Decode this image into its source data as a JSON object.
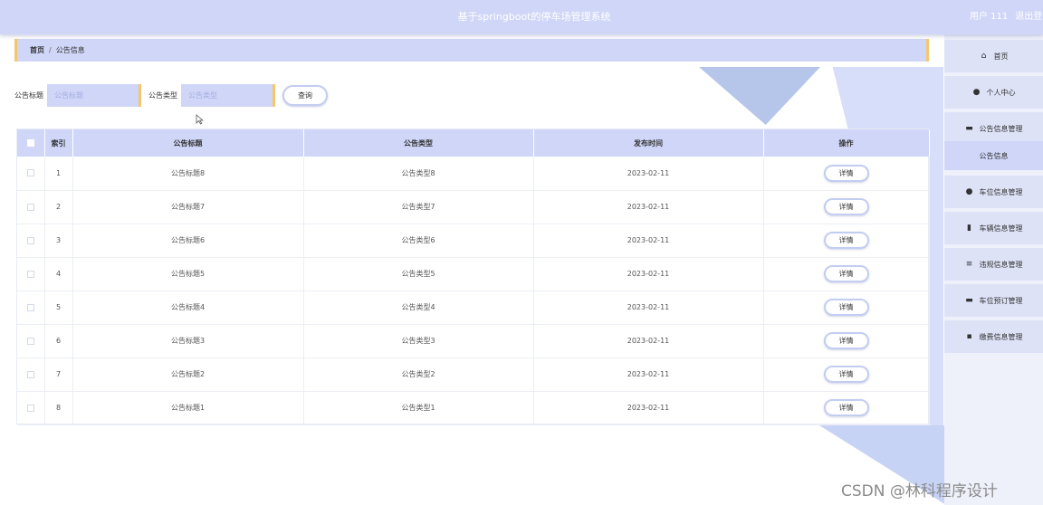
{
  "header": {
    "title": "基于springboot的停车场管理系统",
    "user": "用户 111",
    "logout": "退出登录"
  },
  "breadcrumb": {
    "home": "首页",
    "separator": "/",
    "current": "公告信息"
  },
  "search": {
    "title_label": "公告标题",
    "title_placeholder": "公告标题",
    "type_label": "公告类型",
    "type_placeholder": "公告类型",
    "query_button": "查询"
  },
  "table": {
    "headers": {
      "index": "索引",
      "title": "公告标题",
      "type": "公告类型",
      "time": "发布时间",
      "action": "操作"
    },
    "detail_label": "详情",
    "rows": [
      {
        "index": "1",
        "title": "公告标题8",
        "type": "公告类型8",
        "time": "2023-02-11"
      },
      {
        "index": "2",
        "title": "公告标题7",
        "type": "公告类型7",
        "time": "2023-02-11"
      },
      {
        "index": "3",
        "title": "公告标题6",
        "type": "公告类型6",
        "time": "2023-02-11"
      },
      {
        "index": "4",
        "title": "公告标题5",
        "type": "公告类型5",
        "time": "2023-02-11"
      },
      {
        "index": "5",
        "title": "公告标题4",
        "type": "公告类型4",
        "time": "2023-02-11"
      },
      {
        "index": "6",
        "title": "公告标题3",
        "type": "公告类型3",
        "time": "2023-02-11"
      },
      {
        "index": "7",
        "title": "公告标题2",
        "type": "公告类型2",
        "time": "2023-02-11"
      },
      {
        "index": "8",
        "title": "公告标题1",
        "type": "公告类型1",
        "time": "2023-02-11"
      }
    ]
  },
  "sidebar": {
    "items": [
      {
        "label": "首页",
        "icon": "home-icon",
        "glyph": "⌂"
      },
      {
        "label": "个人中心",
        "icon": "user-icon",
        "glyph": "●"
      },
      {
        "label": "公告信息管理",
        "icon": "monitor-icon",
        "glyph": "▬"
      },
      {
        "label": "公告信息",
        "icon": "",
        "glyph": ""
      },
      {
        "label": "车位信息管理",
        "icon": "person-icon",
        "glyph": "●"
      },
      {
        "label": "车辆信息管理",
        "icon": "chart-icon",
        "glyph": "▮"
      },
      {
        "label": "违规信息管理",
        "icon": "list-icon",
        "glyph": "≡"
      },
      {
        "label": "车位预订管理",
        "icon": "message-icon",
        "glyph": "▬"
      },
      {
        "label": "缴费信息管理",
        "icon": "grid-icon",
        "glyph": "▪"
      }
    ]
  },
  "watermark": "CSDN @林科程序设计",
  "colors": {
    "header_bg": "#cfd6f7",
    "accent": "#f5c76a",
    "button_border": "#c3cdf1"
  }
}
